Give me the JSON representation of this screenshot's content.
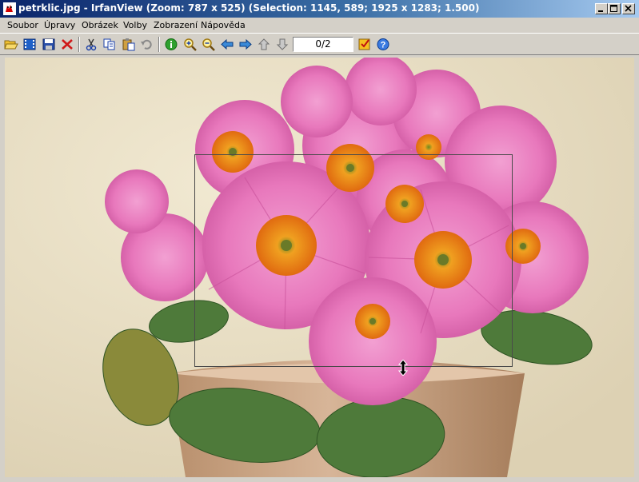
{
  "window": {
    "title": "petrklic.jpg - IrfanView (Zoom: 787 x 525) (Selection: 1145, 589; 1925 x 1283; 1.500)",
    "app_icon": "irfanview-cat-icon"
  },
  "title_buttons": [
    {
      "name": "minimize-button",
      "icon": "minimize-icon"
    },
    {
      "name": "maximize-button",
      "icon": "maximize-icon"
    },
    {
      "name": "close-button",
      "icon": "close-icon"
    }
  ],
  "menu": {
    "items": [
      "Soubor",
      "Úpravy",
      "Obrázek",
      "Volby",
      "Zobrazení",
      "Nápověda"
    ]
  },
  "toolbar": {
    "buttons": [
      "open-folder-icon",
      "slideshow-icon",
      "save-icon",
      "delete-icon",
      "cut-icon",
      "copy-icon",
      "paste-icon",
      "undo-icon",
      "info-icon",
      "zoom-in-icon",
      "zoom-out-icon",
      "previous-icon",
      "next-icon",
      "first-icon",
      "last-icon",
      "thumbnails-icon",
      "help-icon"
    ],
    "page_indicator": "0/2"
  },
  "colors": {
    "title_gradient_start": "#0a246a",
    "title_gradient_end": "#a6caf0",
    "chrome": "#d4d0c8",
    "wall_background": "#ece2c8",
    "petal_pink": "#e870b8",
    "flower_center_orange": "#e8861a",
    "leaf_green": "#4e7a3a",
    "pot_terracotta": "#c9a283"
  },
  "cursor": "vertical-resize-cursor"
}
